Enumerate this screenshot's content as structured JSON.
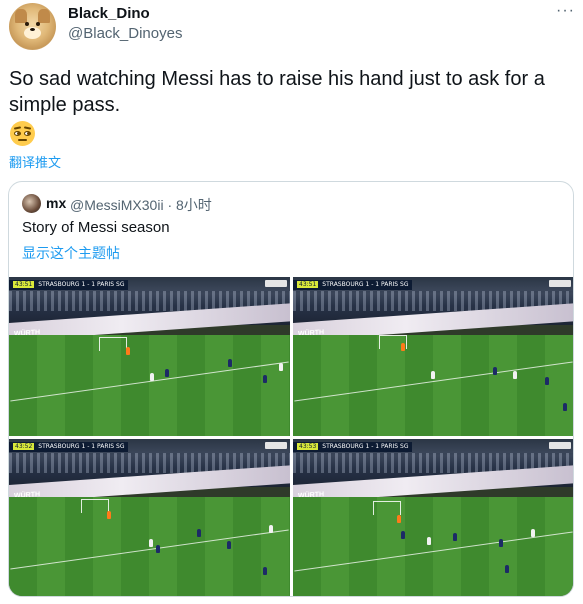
{
  "author": {
    "display_name": "Black_Dino",
    "handle": "@Black_Dinoyes"
  },
  "more_label": "···",
  "tweet": {
    "text": "So sad watching Messi has to raise his hand just to ask for a simple pass.",
    "emoji": "face-with-rolling-eyes",
    "translate_label": "翻译推文"
  },
  "quoted": {
    "name": "mx",
    "handle_time": "@MessiMX30ii · 8小时",
    "text": "Story of Messi season",
    "show_topic_label": "显示这个主题帖"
  },
  "media": {
    "frames": [
      {
        "clock": "43:51",
        "home": "STRASBOURG",
        "score": "1 - 1",
        "away": "PARIS SG",
        "board": "WÜRTH"
      },
      {
        "clock": "43:51",
        "home": "STRASBOURG",
        "score": "1 - 1",
        "away": "PARIS SG",
        "board": "WÜRTH"
      },
      {
        "clock": "43:52",
        "home": "STRASBOURG",
        "score": "1 - 1",
        "away": "PARIS SG",
        "board": "WÜRTH"
      },
      {
        "clock": "43:53",
        "home": "STRASBOURG",
        "score": "1 - 1",
        "away": "PARIS SG",
        "board": "WÜRTH"
      }
    ]
  },
  "colors": {
    "link": "#1d9bf0",
    "muted": "#536471",
    "border": "#cfd9de",
    "pitch": "#4a9636"
  }
}
